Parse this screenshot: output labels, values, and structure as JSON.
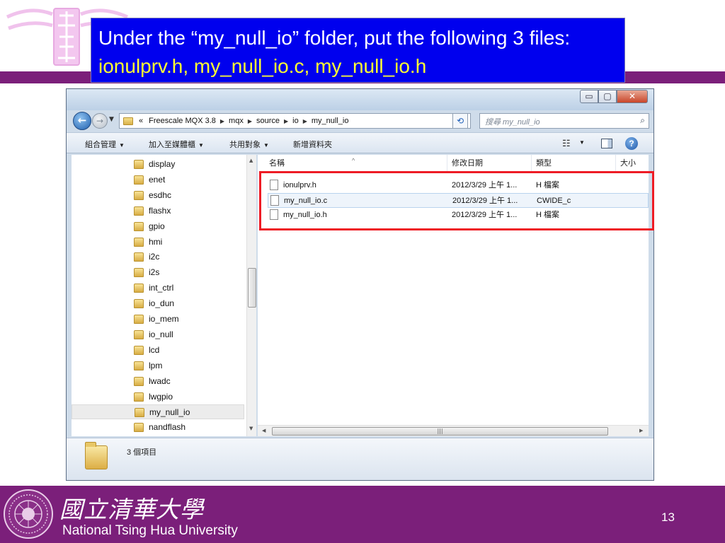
{
  "slide": {
    "title_prefix": "Under the “my_null_io” folder, put the following 3 files: ",
    "title_files": "ionulprv.h, my_null_io.c, my_null_io.h",
    "university_cn": "國立清華大學",
    "university_en": "National Tsing Hua University",
    "page_number": "13"
  },
  "window": {
    "caption": {
      "minimize": "▭",
      "maximize": "▢",
      "close": "✕"
    },
    "address": {
      "overflow": "«",
      "crumbs": [
        "Freescale MQX 3.8",
        "mqx",
        "source",
        "io",
        "my_null_io"
      ]
    },
    "search_placeholder": "搜尋 my_null_io",
    "toolbar": {
      "organize": "組合管理",
      "add_to_library": "加入至媒體櫃",
      "share_with": "共用對象",
      "new_folder": "新增資料夾"
    },
    "nav_folders": [
      "display",
      "enet",
      "esdhc",
      "flashx",
      "gpio",
      "hmi",
      "i2c",
      "i2s",
      "int_ctrl",
      "io_dun",
      "io_mem",
      "io_null",
      "lcd",
      "lpm",
      "lwadc",
      "lwgpio",
      "my_null_io",
      "nandflash"
    ],
    "selected_folder": "my_null_io",
    "columns": {
      "name": "名稱",
      "date": "修改日期",
      "type": "類型",
      "size": "大小"
    },
    "files": [
      {
        "name": "ionulprv.h",
        "date": "2012/3/29 上午 1...",
        "type": "H 檔案"
      },
      {
        "name": "my_null_io.c",
        "date": "2012/3/29 上午 1...",
        "type": "CWIDE_c"
      },
      {
        "name": "my_null_io.h",
        "date": "2012/3/29 上午 1...",
        "type": "H 檔案"
      }
    ],
    "status": {
      "item_count": "3 個項目"
    }
  },
  "colors": {
    "band": "#7b1f7a",
    "title_bg": "#0000ee",
    "title_highlight": "#ffff33",
    "annotation": "#ee1c25"
  }
}
